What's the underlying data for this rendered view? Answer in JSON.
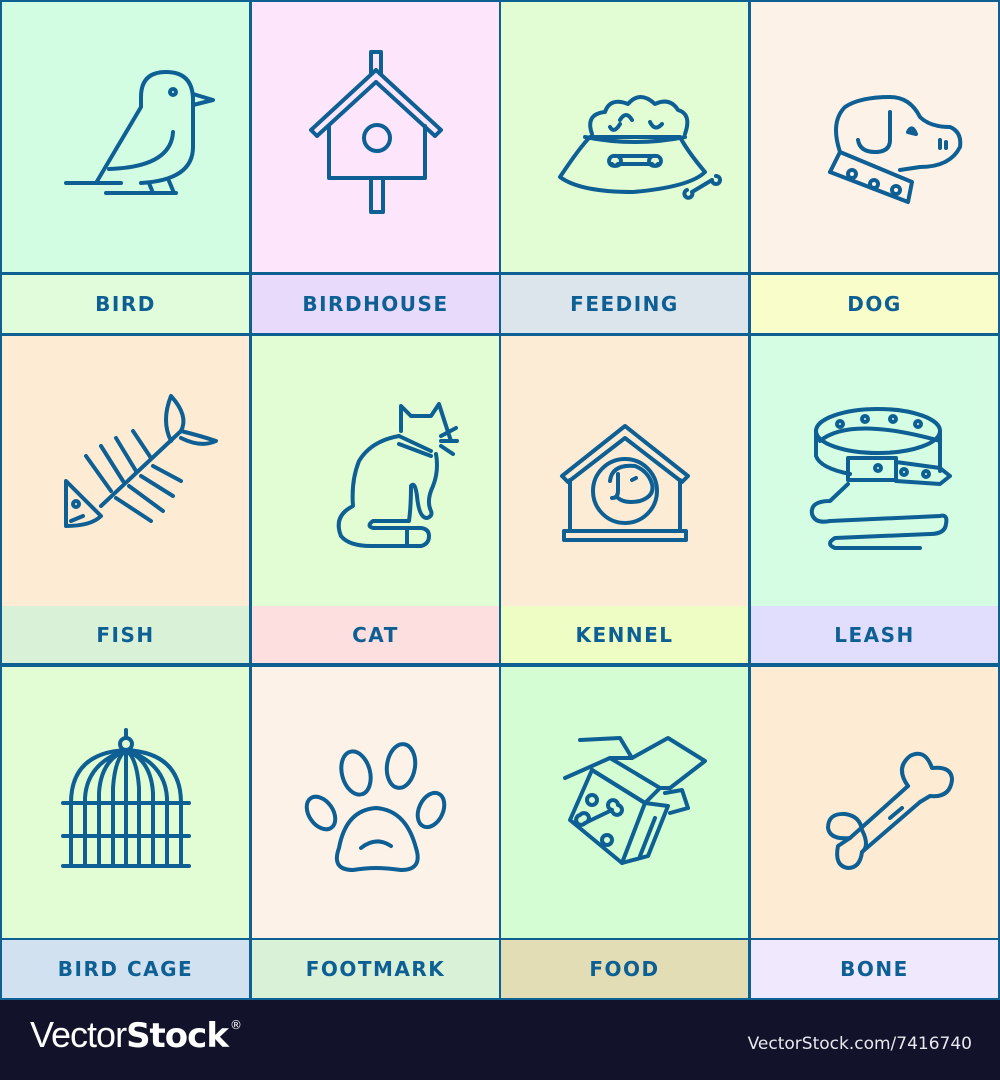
{
  "colors": {
    "line": "#0d5f94",
    "footer_bg": "#12132a"
  },
  "cells": [
    {
      "label": "BIRD",
      "icon": "bird-icon",
      "bg": "#d3fde3",
      "label_bg": "#e0fcdb"
    },
    {
      "label": "BIRDHOUSE",
      "icon": "birdhouse-icon",
      "bg": "#fde6fb",
      "label_bg": "#e7dafb"
    },
    {
      "label": "FEEDING",
      "icon": "food-bowl-icon",
      "bg": "#e2fdd3",
      "label_bg": "#dce4ec"
    },
    {
      "label": "DOG",
      "icon": "dog-head-icon",
      "bg": "#fdf2e8",
      "label_bg": "#f9fdc9"
    },
    {
      "label": "FISH",
      "icon": "fish-bone-icon",
      "bg": "#fdecd3",
      "label_bg": "#d9f1d6"
    },
    {
      "label": "CAT",
      "icon": "cat-icon",
      "bg": "#e2fdd3",
      "label_bg": "#fddfdf"
    },
    {
      "label": "KENNEL",
      "icon": "kennel-icon",
      "bg": "#fdecd5",
      "label_bg": "#edfdc4"
    },
    {
      "label": "LEASH",
      "icon": "leash-icon",
      "bg": "#d4fde3",
      "label_bg": "#e0defc"
    },
    {
      "label": "BIRD CAGE",
      "icon": "bird-cage-icon",
      "bg": "#e2fdd3",
      "label_bg": "#d1e1f0"
    },
    {
      "label": "FOOTMARK",
      "icon": "paw-print-icon",
      "bg": "#fdf2e8",
      "label_bg": "#d9f1d6"
    },
    {
      "label": "FOOD",
      "icon": "food-box-icon",
      "bg": "#d4fdd3",
      "label_bg": "#e2ddb4"
    },
    {
      "label": "BONE",
      "icon": "bone-icon",
      "bg": "#fdecd3",
      "label_bg": "#f0e8fd"
    }
  ],
  "footer": {
    "brand_light": "Vector",
    "brand_bold": "Stock",
    "brand_mark": "®",
    "reference": "VectorStock.com/7416740"
  }
}
